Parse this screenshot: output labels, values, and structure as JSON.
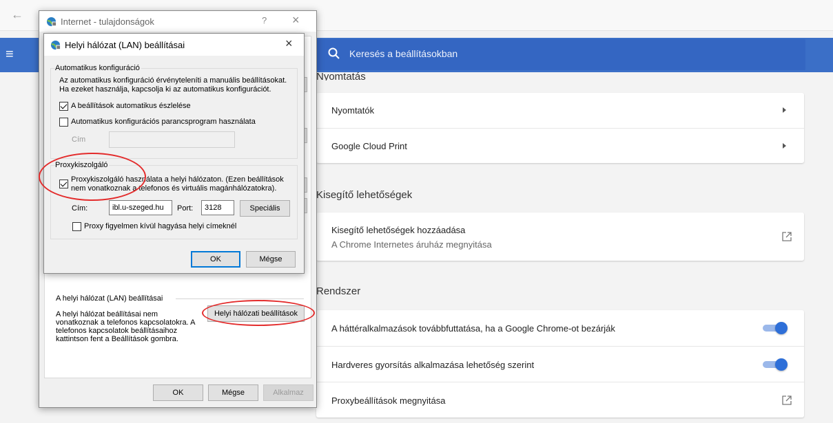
{
  "chrome": {
    "search_placeholder": "Keresés a beállításokban",
    "sections": {
      "printing": {
        "title": "Nyomtatás",
        "rows": [
          "Nyomtatók",
          "Google Cloud Print"
        ]
      },
      "accessibility": {
        "title": "Kisegítő lehetőségek",
        "row_title": "Kisegítő lehetőségek hozzáadása",
        "row_sub": "A Chrome Internetes áruház megnyitása"
      },
      "system": {
        "title": "Rendszer",
        "rows": [
          "A háttéralkalmazások továbbfuttatása, ha a Google Chrome-ot bezárják",
          "Hardveres gyorsítás alkalmazása lehetőség szerint",
          "Proxybeállítások megnyitása"
        ]
      }
    },
    "colors": {
      "header_blue": "#3b6fc7",
      "toggle_on": "#2e6fd8"
    }
  },
  "internet_props": {
    "title": "Internet - tulajdonságok",
    "help": "?",
    "close": "×",
    "lan_section_title": "A helyi hálózat (LAN) beállításai",
    "lan_text": [
      "A helyi hálózat beállításai nem",
      "vonatkoznak a telefonos kapcsolatokra. A",
      "telefonos kapcsolatok beállításaihoz",
      "kattintson fent a Beállítások gombra."
    ],
    "lan_button": "Helyi hálózati beállítások",
    "ok": "OK",
    "cancel": "Mégse",
    "apply": "Alkalmaz"
  },
  "lan_dialog": {
    "title": "Helyi hálózat (LAN) beállításai",
    "close": "×",
    "auto_group": "Automatikus konfiguráció",
    "auto_desc": [
      "Az automatikus konfiguráció érvényteleníti a manuális beállításokat.",
      "Ha ezeket használja, kapcsolja ki az automatikus konfigurációt."
    ],
    "auto_detect": {
      "label": "A beállítások automatikus észlelése",
      "checked": true
    },
    "auto_script": {
      "label": "Automatikus konfigurációs parancsprogram használata",
      "checked": false
    },
    "address_label": "Cím",
    "proxy_group": "Proxykiszolgáló",
    "use_proxy": {
      "label": [
        "Proxykiszolgáló használata a helyi hálózaton. (Ezen beállítások",
        "nem vonatkoznak a telefonos és virtuális magánhálózatokra)."
      ],
      "checked": true
    },
    "proxy_address_label": "Cím:",
    "proxy_address_value": "ibl.u-szeged.hu",
    "port_label": "Port:",
    "port_value": "3128",
    "advanced_button": "Speciális",
    "bypass": {
      "label": "Proxy figyelmen kívül hagyása helyi címeknél",
      "checked": false
    },
    "ok": "OK",
    "cancel": "Mégse"
  }
}
